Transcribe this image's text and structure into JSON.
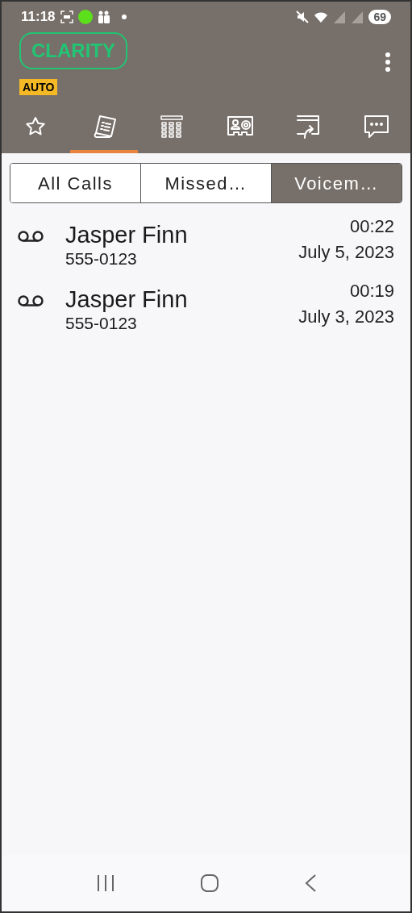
{
  "status_bar": {
    "time": "11:18",
    "battery": "69"
  },
  "app_bar": {
    "logo": "CLARITY",
    "badge": "AUTO"
  },
  "tabs": [
    {
      "kind": "favorites",
      "selected": false
    },
    {
      "kind": "calls",
      "selected": true
    },
    {
      "kind": "keypad",
      "selected": false
    },
    {
      "kind": "contacts",
      "selected": false
    },
    {
      "kind": "share",
      "selected": false
    },
    {
      "kind": "messages",
      "selected": false
    }
  ],
  "filters": [
    {
      "label": "All Calls",
      "selected": false
    },
    {
      "label": "Missed…",
      "selected": false
    },
    {
      "label": "Voicem…",
      "selected": true
    }
  ],
  "voicemails": [
    {
      "name": "Jasper Finn",
      "number": "555-0123",
      "duration": "00:22",
      "date": "July 5, 2023"
    },
    {
      "name": "Jasper Finn",
      "number": "555-0123",
      "duration": "00:19",
      "date": "July 3, 2023"
    }
  ]
}
